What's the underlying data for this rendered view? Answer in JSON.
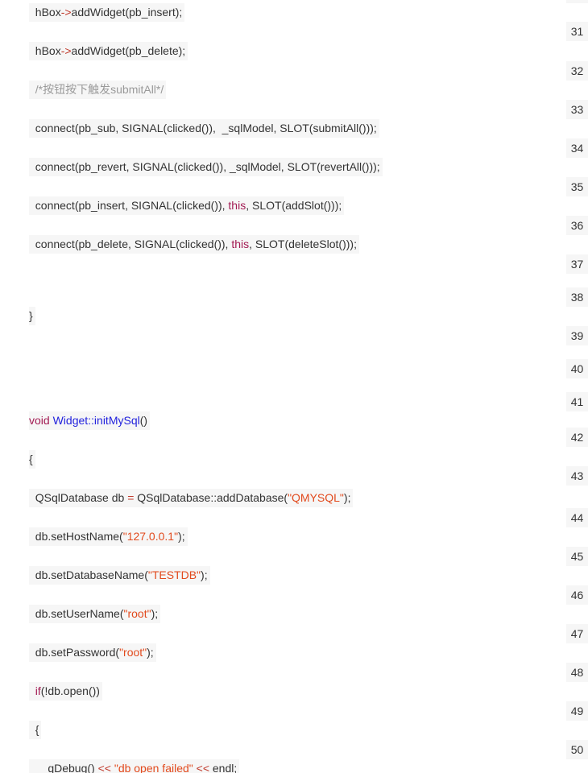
{
  "colors": {
    "keyword": "#a31b53",
    "string": "#e24a1d",
    "operator": "#c0392b",
    "comment": "#9a9a9a",
    "function": "#2222dd",
    "text": "#333333",
    "line_background": "#f6f6f6"
  },
  "code_lines": [
    {
      "tokens": [
        {
          "t": "  hBox"
        },
        {
          "t": "->",
          "c": "op"
        },
        {
          "t": "addWidget(pb_insert);"
        }
      ]
    },
    {
      "tokens": [
        {
          "t": "  hBox"
        },
        {
          "t": "->",
          "c": "op"
        },
        {
          "t": "addWidget(pb_delete);"
        }
      ]
    },
    {
      "tokens": [
        {
          "t": "  /*按钮按下触发submitAll*/",
          "c": "cmt"
        }
      ]
    },
    {
      "tokens": [
        {
          "t": "  connect(pb_sub, SIGNAL(clicked()),  _sqlModel, SLOT(submitAll()));"
        }
      ]
    },
    {
      "tokens": [
        {
          "t": "  connect(pb_revert, SIGNAL(clicked()), _sqlModel, SLOT(revertAll()));"
        }
      ]
    },
    {
      "tokens": [
        {
          "t": "  connect(pb_insert, SIGNAL(clicked()), "
        },
        {
          "t": "this",
          "c": "kw"
        },
        {
          "t": ", SLOT(addSlot()));"
        }
      ]
    },
    {
      "tokens": [
        {
          "t": "  connect(pb_delete, SIGNAL(clicked()), "
        },
        {
          "t": "this",
          "c": "kw"
        },
        {
          "t": ", SLOT(deleteSlot()));"
        }
      ]
    },
    {
      "tokens": [
        {
          "t": "}"
        }
      ]
    },
    {
      "tokens": [
        {
          "t": "void",
          "c": "kw"
        },
        {
          "t": " "
        },
        {
          "t": "Widget::initMySql",
          "c": "fn"
        },
        {
          "t": "()"
        }
      ]
    },
    {
      "tokens": [
        {
          "t": "{"
        }
      ]
    },
    {
      "tokens": [
        {
          "t": "  QSqlDatabase db "
        },
        {
          "t": "=",
          "c": "op"
        },
        {
          "t": " QSqlDatabase::addDatabase("
        },
        {
          "t": "\"QMYSQL\"",
          "c": "str"
        },
        {
          "t": ");"
        }
      ]
    },
    {
      "tokens": [
        {
          "t": "  db.setHostName("
        },
        {
          "t": "\"127.0.0.1\"",
          "c": "str"
        },
        {
          "t": ");"
        }
      ]
    },
    {
      "tokens": [
        {
          "t": "  db.setDatabaseName("
        },
        {
          "t": "\"TESTDB\"",
          "c": "str"
        },
        {
          "t": ");"
        }
      ]
    },
    {
      "tokens": [
        {
          "t": "  db.setUserName("
        },
        {
          "t": "\"root\"",
          "c": "str"
        },
        {
          "t": ");"
        }
      ]
    },
    {
      "tokens": [
        {
          "t": "  db.setPassword("
        },
        {
          "t": "\"root\"",
          "c": "str"
        },
        {
          "t": ");"
        }
      ]
    },
    {
      "tokens": [
        {
          "t": "  "
        },
        {
          "t": "if",
          "c": "kw"
        },
        {
          "t": "(!db.open())"
        }
      ]
    },
    {
      "tokens": [
        {
          "t": "  {"
        }
      ]
    },
    {
      "tokens": [
        {
          "t": "      qDebug() "
        },
        {
          "t": "<<",
          "c": "op"
        },
        {
          "t": " "
        },
        {
          "t": "\"db open failed\"",
          "c": "str"
        },
        {
          "t": " "
        },
        {
          "t": "<<",
          "c": "op"
        },
        {
          "t": " endl;"
        }
      ]
    }
  ],
  "line_numbers": [
    "31",
    "32",
    "33",
    "34",
    "35",
    "36",
    "37",
    "38",
    "39",
    "40",
    "41",
    "42",
    "43",
    "44",
    "45",
    "46",
    "47",
    "48",
    "49",
    "50"
  ]
}
